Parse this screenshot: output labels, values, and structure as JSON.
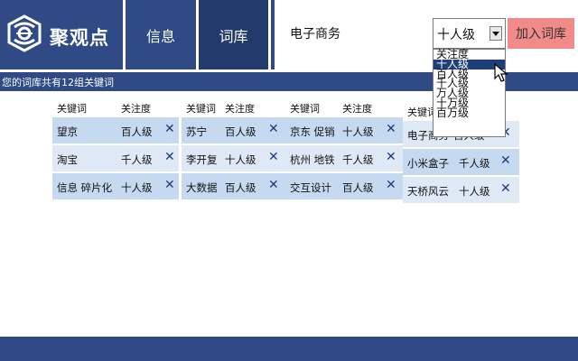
{
  "logo": {
    "text": "聚观点"
  },
  "nav": {
    "tabs": [
      {
        "label": "信息"
      },
      {
        "label": "词库"
      }
    ]
  },
  "search": {
    "keyword_value": "电子商务",
    "level_selected": "十人级",
    "add_label": "加入词库"
  },
  "dropdown": {
    "options": [
      "关注度",
      "十人级",
      "百人级",
      "千人级",
      "万人级",
      "十万级",
      "百万级"
    ],
    "selected_index": 1
  },
  "summary": {
    "text": "您的词库共有12组关键词"
  },
  "table": {
    "header_keyword": "关键词",
    "header_level": "关注度",
    "columns": [
      {
        "rows": [
          {
            "keyword": "望京",
            "level": "百人级"
          },
          {
            "keyword": "淘宝",
            "level": "千人级"
          },
          {
            "keyword": "信息 碎片化",
            "level": "十人级"
          }
        ]
      },
      {
        "rows": [
          {
            "keyword": "苏宁",
            "level": "百人级"
          },
          {
            "keyword": "李开复",
            "level": "十人级"
          },
          {
            "keyword": "大数据",
            "level": "百人级"
          }
        ]
      },
      {
        "rows": [
          {
            "keyword": "京东 促销",
            "level": "十人级"
          },
          {
            "keyword": "杭州 地铁",
            "level": "千人级"
          },
          {
            "keyword": "交互设计",
            "level": "百人级"
          }
        ]
      },
      {
        "rows": [
          {
            "keyword": "电子商务",
            "level": "百人级"
          },
          {
            "keyword": "小米盒子",
            "level": "千人级"
          },
          {
            "keyword": "天桥风云",
            "level": "十人级"
          }
        ]
      }
    ]
  },
  "colors": {
    "header_bg": "#2f4a84",
    "active_tab": "#233a6d",
    "row_a": "#c5d9f1",
    "row_b": "#dfe9f6",
    "add_btn": "#f28a8a"
  }
}
